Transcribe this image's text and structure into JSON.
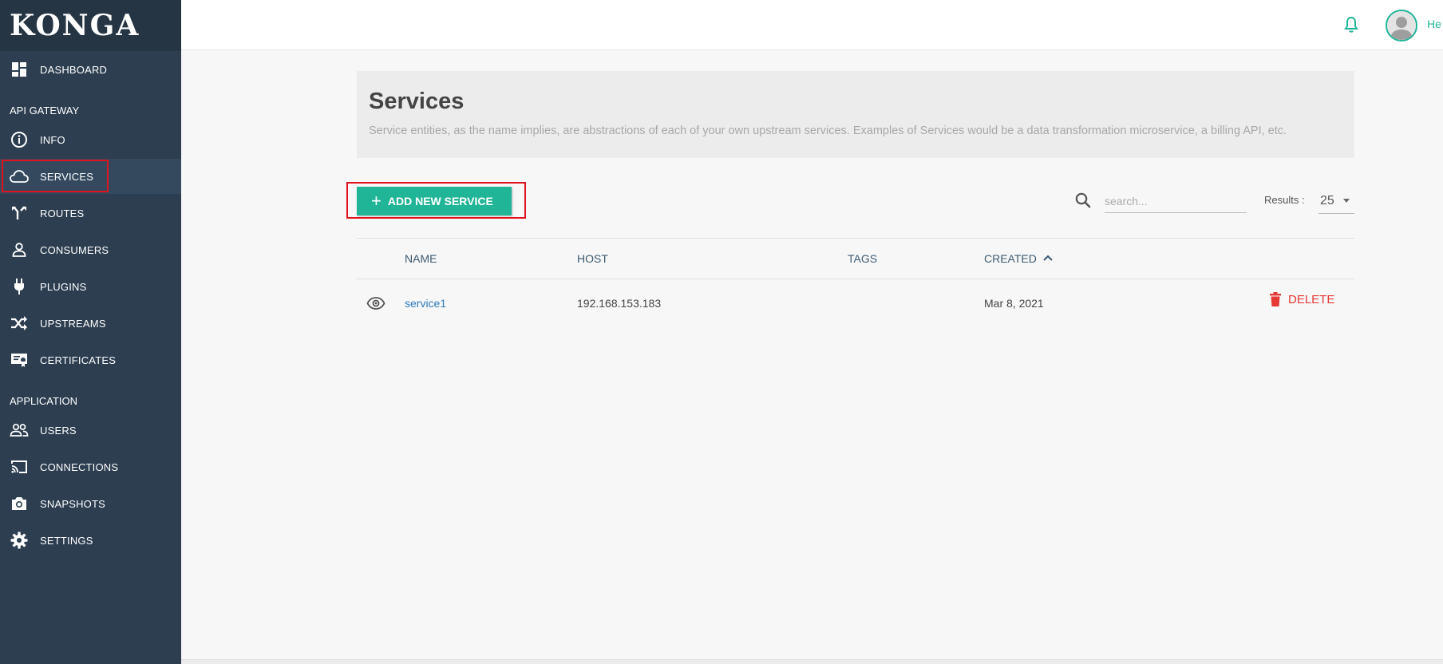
{
  "sidebar": {
    "logo": "KONGA",
    "dashboard": "DASHBOARD",
    "section_api_gateway": "API GATEWAY",
    "info": "INFO",
    "services": "SERVICES",
    "routes": "ROUTES",
    "consumers": "CONSUMERS",
    "plugins": "PLUGINS",
    "upstreams": "UPSTREAMS",
    "certificates": "CERTIFICATES",
    "section_application": "APPLICATION",
    "users": "USERS",
    "connections": "CONNECTIONS",
    "snapshots": "SNAPSHOTS",
    "settings": "SETTINGS",
    "active_item": "SERVICES"
  },
  "topbar": {
    "user_name": "He"
  },
  "page": {
    "title": "Services",
    "description": "Service entities, as the name implies, are abstractions of each of your own upstream services. Examples of Services would be a data transformation microservice, a billing API, etc.",
    "add_button": "ADD NEW SERVICE",
    "search_placeholder": "search...",
    "results_label": "Results :",
    "results_value": "25"
  },
  "table": {
    "columns": {
      "name": "NAME",
      "host": "HOST",
      "tags": "TAGS",
      "created": "CREATED"
    },
    "rows": [
      {
        "name": "service1",
        "host": "192.168.153.183",
        "tags": "",
        "created": "Mar 8, 2021",
        "delete_label": "DELETE"
      }
    ]
  },
  "colors": {
    "sidebar": "#2c3e50",
    "accent": "#21b598",
    "link": "#2c7bbd",
    "danger": "#e53935",
    "highlight": "#e0141e"
  }
}
